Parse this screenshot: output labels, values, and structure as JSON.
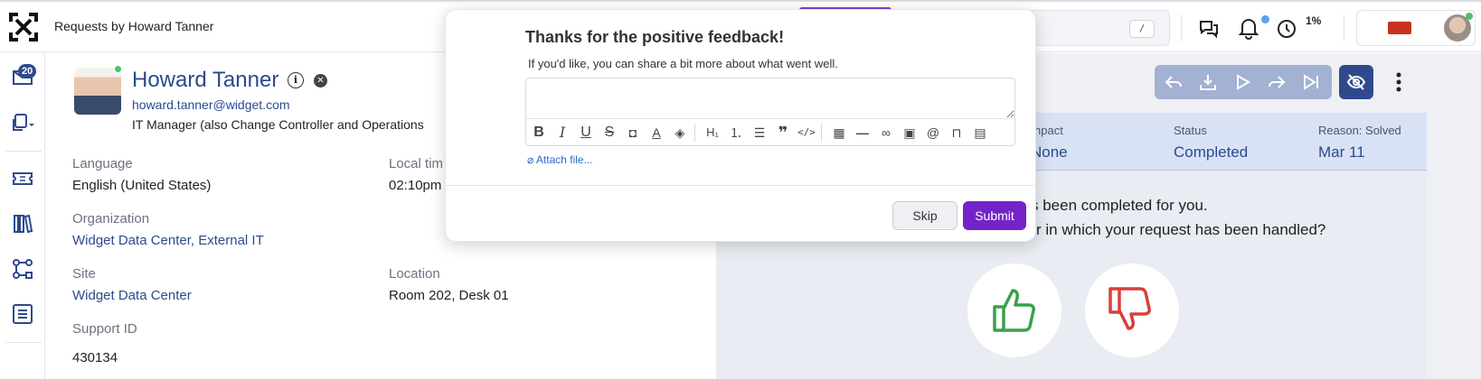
{
  "header": {
    "title": "Requests by Howard Tanner",
    "search_shortcut": "/",
    "progress_label": "1%"
  },
  "sidebar": {
    "inbox_badge": "20"
  },
  "profile": {
    "name": "Howard Tanner",
    "email": "howard.tanner@widget.com",
    "job_title": "IT Manager (also Change Controller and Operations",
    "language_label": "Language",
    "language_value": "English (United States)",
    "local_time_label": "Local tim",
    "local_time_value": "02:10pm",
    "organization_label": "Organization",
    "organization_value": "Widget Data Center, External IT",
    "site_label": "Site",
    "site_value": "Widget Data Center",
    "location_label": "Location",
    "location_value": "Room 202, Desk 01",
    "support_id_label": "Support ID",
    "support_id_value": "430134"
  },
  "summary": {
    "impact_label": "npact",
    "impact_value": "None",
    "status_label": "Status",
    "status_value": "Completed",
    "reason_label": "Reason: Solved",
    "reason_value": "Mar 11"
  },
  "message": {
    "line1": "s been completed for you.",
    "line2": "r in which your request has been handled?"
  },
  "modal": {
    "title": "Thanks for the positive feedback!",
    "subtitle": "If you'd like, you can share a bit more about what went well.",
    "attach_label": "Attach file...",
    "skip_label": "Skip",
    "submit_label": "Submit"
  },
  "colors": {
    "accent": "#7423c9",
    "brand_blue": "#2e4a8c",
    "link": "#2a4a8f",
    "thumb_up": "#3aa14a",
    "thumb_down": "#d9403a",
    "online": "#4cc36a"
  },
  "icons": {
    "toolbar": [
      "reply-icon",
      "download-icon",
      "play-icon",
      "forward-icon",
      "skip-end-icon",
      "eye-off-icon",
      "kebab-icon"
    ],
    "editor": [
      "bold-icon",
      "italic-icon",
      "underline-icon",
      "strikethrough-icon",
      "highlight-icon",
      "text-color-icon",
      "fill-icon",
      "heading-icon",
      "ordered-list-icon",
      "bullet-list-icon",
      "quote-icon",
      "code-icon",
      "table-icon",
      "horizontal-rule-icon",
      "link-icon",
      "image-icon",
      "mention-icon",
      "bookmark-icon",
      "snippet-icon"
    ]
  }
}
